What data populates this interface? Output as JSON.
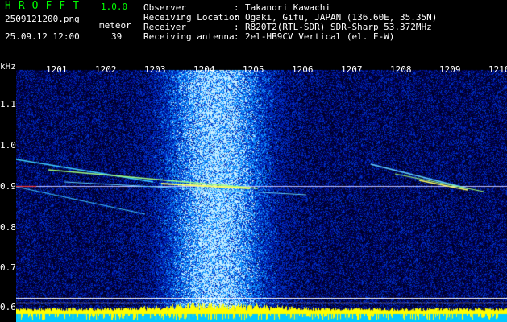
{
  "header": {
    "app_title": "HROFFT",
    "version": "1.0.0",
    "filename": "2509121200.png",
    "meteor_label": "meteor",
    "datetime": "25.09.12 12:00",
    "meteor_count": "39"
  },
  "station": [
    {
      "label": "Observer",
      "value": "Takanori Kawachi"
    },
    {
      "label": "Receiving Location",
      "value": "Ogaki, Gifu, JAPAN (136.60E, 35.35N)"
    },
    {
      "label": "Receiver",
      "value": "R820T2(RTL-SDR) SDR-Sharp 53.372MHz"
    },
    {
      "label": "Receiving antenna",
      "value": "2el-HB9CV Vertical (el. E-W)"
    }
  ],
  "axes": {
    "y_unit": "kHz",
    "y_ticks": [
      "1.1",
      "1.0",
      "0.9",
      "0.8",
      "0.7",
      "0.6"
    ],
    "x_ticks": [
      "1201",
      "1202",
      "1203",
      "1204",
      "1205",
      "1206",
      "1207",
      "1208",
      "1209",
      "1210"
    ]
  },
  "colors": {
    "title": "#00ff00",
    "text": "#ffffff",
    "background": "#000000",
    "noise_floor": "#000a80",
    "band": "#00aaff",
    "signal": "#ffff00",
    "baseline": "#00cccc",
    "carrier": "#ff6060"
  }
}
